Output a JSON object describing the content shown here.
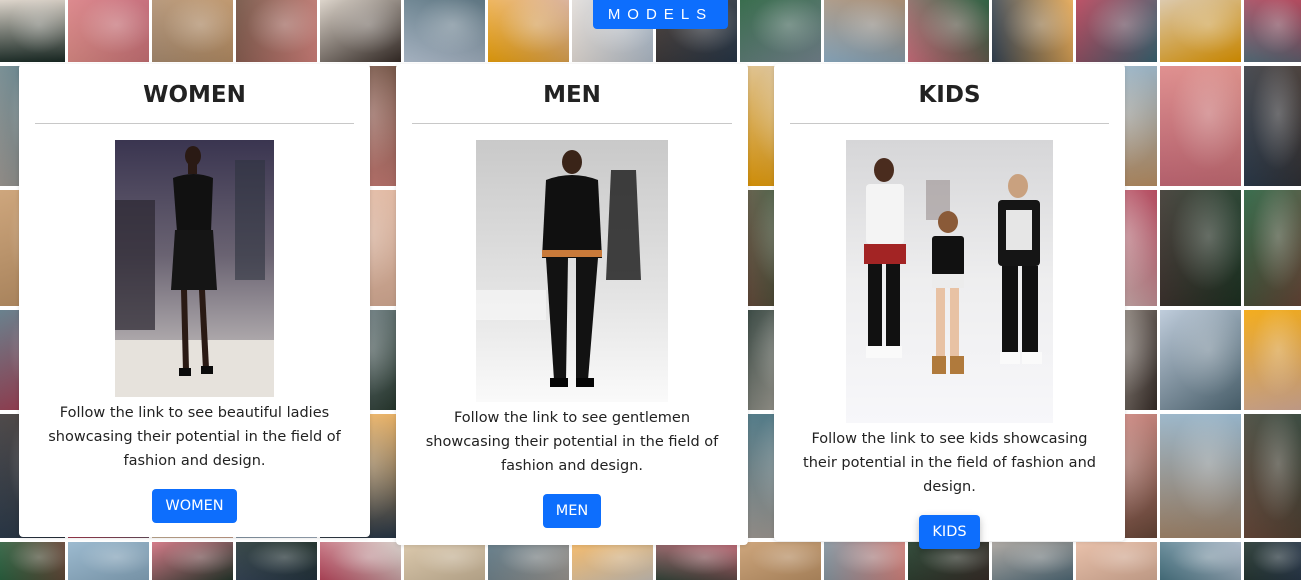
{
  "header": {
    "models_label": "MODELS"
  },
  "cards": {
    "women": {
      "title": "WOMEN",
      "description": "Follow the link to see beautiful ladies showcasing their potential in the field of fashion and design.",
      "button_label": "WOMEN",
      "photo_alt": "Female model walking the runway in a black leather dress"
    },
    "men": {
      "title": "MEN",
      "description": "Follow the link to see gentlemen showcasing their potential in the field of fashion and design.",
      "button_label": "MEN",
      "photo_alt": "Male model walking the runway in a black suit"
    },
    "kids": {
      "title": "KIDS",
      "description": "Follow the link to see kids showcasing their potential in the field of fashion and design.",
      "button_label": "KIDS",
      "photo_alt": "Three kids walking the runway together"
    }
  },
  "colors": {
    "accent": "#0d6efd",
    "card_background": "#ffffff",
    "text": "#222222"
  },
  "background": {
    "tile_colors": [
      "#1b2d27",
      "#e08a84",
      "#a98a6d",
      "#6c4a3a",
      "#d8cfc4",
      "#b7c6d7",
      "#f2a200",
      "#e7dfd8",
      "#3a2f2a",
      "#1f5a36",
      "#8fb1c9",
      "#cf6b7a",
      "#2a3a4c",
      "#b33b52",
      "#d7c2a2",
      "#55707e",
      "#f4b35a",
      "#283a2e",
      "#c79a6b",
      "#7e8f9a",
      "#193522",
      "#a6a09a",
      "#e6b9a0",
      "#3d6b7a"
    ]
  }
}
